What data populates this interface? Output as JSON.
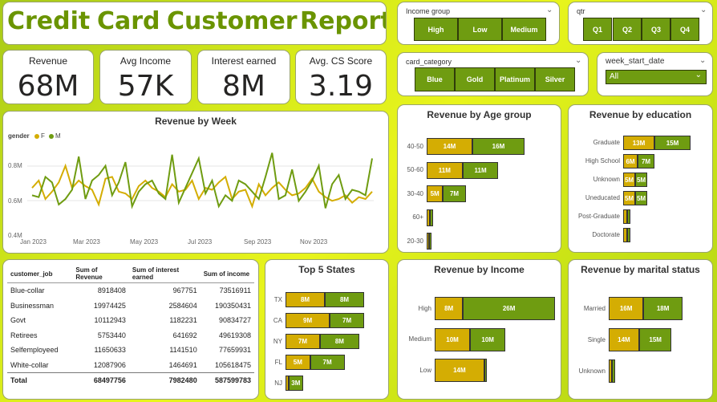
{
  "header": {
    "words": [
      "Credit",
      "Card",
      "Customer",
      "Report"
    ]
  },
  "kpis": [
    {
      "label": "Revenue",
      "value": "68M"
    },
    {
      "label": "Avg Income",
      "value": "57K"
    },
    {
      "label": "Interest earned",
      "value": "8M"
    },
    {
      "label": "Avg. CS Score",
      "value": "3.19"
    }
  ],
  "slicers": {
    "income_group": {
      "title": "Income group",
      "options": [
        "High",
        "Low",
        "Medium"
      ]
    },
    "qtr": {
      "title": "qtr",
      "options": [
        "Q1",
        "Q2",
        "Q3",
        "Q4"
      ]
    },
    "card_category": {
      "title": "card_category",
      "options": [
        "Blue",
        "Gold",
        "Platinum",
        "Silver"
      ]
    },
    "week_start_date": {
      "title": "week_start_date",
      "selected": "All"
    }
  },
  "colors": {
    "female": "#d4ad03",
    "male": "#6f9c11",
    "brand": "#6a9400"
  },
  "revenue_by_week": {
    "title": "Revenue by Week",
    "legend_title": "gender",
    "legend": [
      "F",
      "M"
    ],
    "y_ticks": [
      "0.8M",
      "0.6M",
      "0.4M"
    ],
    "x_ticks": [
      "Jan 2023",
      "Mar 2023",
      "May 2023",
      "Jul 2023",
      "Sep 2023",
      "Nov 2023"
    ]
  },
  "table": {
    "headers": [
      "customer_job",
      "Sum of Revenue",
      "Sum of interest earned",
      "Sum of income"
    ],
    "rows": [
      [
        "Blue-collar",
        "8918408",
        "967751",
        "73516911"
      ],
      [
        "Businessman",
        "19974425",
        "2584604",
        "190350431"
      ],
      [
        "Govt",
        "10112943",
        "1182231",
        "90834727"
      ],
      [
        "Retirees",
        "5753440",
        "641692",
        "49619308"
      ],
      [
        "Selfemployeed",
        "11650633",
        "1141510",
        "77659931"
      ],
      [
        "White-collar",
        "12087906",
        "1464691",
        "105618475"
      ]
    ],
    "total": [
      "Total",
      "68497756",
      "7982480",
      "587599783"
    ]
  },
  "chart_data": [
    {
      "type": "line",
      "title": "Revenue by Week",
      "legend_title": "gender",
      "x_ticks": [
        "Jan 2023",
        "Mar 2023",
        "May 2023",
        "Jul 2023",
        "Sep 2023",
        "Nov 2023"
      ],
      "ylim": [
        400000,
        900000
      ],
      "series": [
        {
          "name": "F",
          "values": [
            660000,
            700000,
            600000,
            640000,
            690000,
            780000,
            660000,
            700000,
            670000,
            650000,
            570000,
            710000,
            720000,
            640000,
            630000,
            600000,
            670000,
            700000,
            660000,
            640000,
            610000,
            680000,
            640000,
            650000,
            700000,
            600000,
            660000,
            650000,
            690000,
            720000,
            600000,
            640000,
            650000,
            560000,
            680000,
            620000,
            660000,
            690000,
            650000,
            620000,
            630000,
            660000,
            710000,
            640000,
            610000,
            590000,
            600000,
            620000,
            580000,
            610000,
            600000,
            640000
          ]
        },
        {
          "name": "M",
          "values": [
            620000,
            610000,
            720000,
            690000,
            570000,
            600000,
            650000,
            830000,
            600000,
            700000,
            730000,
            780000,
            620000,
            690000,
            800000,
            560000,
            640000,
            680000,
            700000,
            630000,
            600000,
            840000,
            580000,
            660000,
            740000,
            820000,
            630000,
            700000,
            560000,
            620000,
            590000,
            700000,
            680000,
            640000,
            600000,
            720000,
            850000,
            600000,
            620000,
            760000,
            590000,
            640000,
            700000,
            780000,
            550000,
            680000,
            730000,
            600000,
            650000,
            640000,
            620000,
            820000
          ]
        }
      ]
    },
    {
      "type": "bar",
      "title": "Revenue by Age group",
      "categories": [
        "40-50",
        "50-60",
        "30-40",
        "60+",
        "20-30"
      ],
      "series": [
        {
          "name": "F",
          "values": [
            14,
            11,
            5,
            1,
            0.5
          ]
        },
        {
          "name": "M",
          "values": [
            16,
            11,
            7,
            1,
            0.5
          ]
        }
      ],
      "labels": [
        [
          "14M",
          "16M"
        ],
        [
          "11M",
          "11M"
        ],
        [
          "5M",
          "7M"
        ],
        [
          "",
          ""
        ],
        [
          "",
          ""
        ]
      ]
    },
    {
      "type": "bar",
      "title": "Revenue by education",
      "categories": [
        "Graduate",
        "High School",
        "Unknown",
        "Uneducated",
        "Post-Graduate",
        "Doctorate"
      ],
      "series": [
        {
          "name": "F",
          "values": [
            13,
            6,
            5,
            5,
            1.5,
            1.5
          ]
        },
        {
          "name": "M",
          "values": [
            15,
            7,
            5,
            5,
            1.5,
            1.5
          ]
        }
      ],
      "labels": [
        [
          "13M",
          "15M"
        ],
        [
          "6M",
          "7M"
        ],
        [
          "5M",
          "5M"
        ],
        [
          "5M",
          "5M"
        ],
        [
          "",
          ""
        ],
        [
          "",
          ""
        ]
      ]
    },
    {
      "type": "bar",
      "title": "Top 5 States",
      "categories": [
        "TX",
        "CA",
        "NY",
        "FL",
        "NJ"
      ],
      "series": [
        {
          "name": "F",
          "values": [
            8,
            9,
            7,
            5,
            0.6
          ]
        },
        {
          "name": "M",
          "values": [
            8,
            7,
            8,
            7,
            3
          ]
        }
      ],
      "labels": [
        [
          "8M",
          "8M"
        ],
        [
          "9M",
          "7M"
        ],
        [
          "7M",
          "8M"
        ],
        [
          "5M",
          "7M"
        ],
        [
          "",
          "3M"
        ]
      ]
    },
    {
      "type": "bar",
      "title": "Revenue by Income",
      "categories": [
        "High",
        "Medium",
        "Low"
      ],
      "series": [
        {
          "name": "F",
          "values": [
            8,
            10,
            14
          ]
        },
        {
          "name": "M",
          "values": [
            26,
            10,
            0.6
          ]
        }
      ],
      "labels": [
        [
          "8M",
          "26M"
        ],
        [
          "10M",
          "10M"
        ],
        [
          "14M",
          ""
        ]
      ]
    },
    {
      "type": "bar",
      "title": "Revenue by marital status",
      "categories": [
        "Married",
        "Single",
        "Unknown"
      ],
      "series": [
        {
          "name": "F",
          "values": [
            16,
            14,
            1.5
          ]
        },
        {
          "name": "M",
          "values": [
            18,
            15,
            1.5
          ]
        }
      ],
      "labels": [
        [
          "16M",
          "18M"
        ],
        [
          "14M",
          "15M"
        ],
        [
          "",
          ""
        ]
      ]
    }
  ]
}
